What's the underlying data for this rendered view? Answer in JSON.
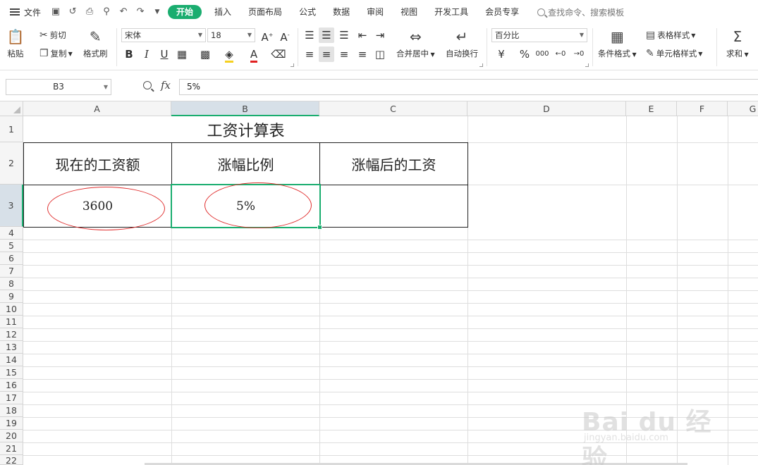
{
  "menubar": {
    "file_label": "文件",
    "tabs": [
      {
        "label": "开始",
        "active": true
      },
      {
        "label": "插入",
        "active": false
      },
      {
        "label": "页面布局",
        "active": false
      },
      {
        "label": "公式",
        "active": false
      },
      {
        "label": "数据",
        "active": false
      },
      {
        "label": "审阅",
        "active": false
      },
      {
        "label": "视图",
        "active": false
      },
      {
        "label": "开发工具",
        "active": false
      },
      {
        "label": "会员专享",
        "active": false
      }
    ],
    "search_placeholder": "查找命令、搜索模板"
  },
  "ribbon": {
    "paste_label": "粘贴",
    "cut_label": "剪切",
    "copy_label": "复制",
    "format_painter_label": "格式刷",
    "font_name": "宋体",
    "font_size": "18",
    "merge_center_label": "合并居中",
    "wrap_text_label": "自动换行",
    "number_format": "百分比",
    "conditional_format_label": "条件格式",
    "table_style_label": "表格样式",
    "cell_style_label": "单元格样式",
    "sum_label": "求和"
  },
  "formula_bar": {
    "name_box": "B3",
    "fx_label": "fx",
    "formula": "5%"
  },
  "sheet": {
    "columns": [
      "A",
      "B",
      "C",
      "D",
      "E",
      "F",
      "G"
    ],
    "rows": [
      "1",
      "2",
      "3",
      "4",
      "5",
      "6",
      "7",
      "8",
      "9",
      "10",
      "11",
      "12",
      "13",
      "14",
      "15",
      "16",
      "17",
      "18",
      "19",
      "20",
      "21",
      "22"
    ],
    "title": "工资计算表",
    "headers": [
      "现在的工资额",
      "涨幅比例",
      "涨幅后的工资"
    ],
    "values": [
      "3600",
      "5%",
      ""
    ],
    "selected_cell": "B3"
  },
  "watermark": {
    "brand": "Bai du 经验",
    "url": "jingyan.baidu.com"
  },
  "colors": {
    "accent": "#1aad6f",
    "annotation": "#e03030"
  }
}
